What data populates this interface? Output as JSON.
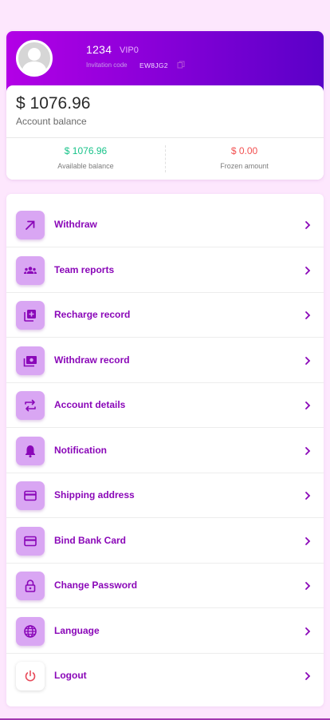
{
  "profile": {
    "username": "1234",
    "vip_level": "VIP0",
    "invitation_label": "Invitation code",
    "invitation_code": "EW8JG2",
    "balance": "$ 1076.96",
    "balance_label": "Account balance",
    "available_value": "$ 1076.96",
    "available_label": "Available balance",
    "frozen_value": "$ 0.00",
    "frozen_label": "Frozen amount"
  },
  "menu": {
    "items": [
      {
        "label": "Withdraw",
        "icon": "arrow-up-right-icon"
      },
      {
        "label": "Team reports",
        "icon": "team-icon"
      },
      {
        "label": "Recharge record",
        "icon": "add-box-icon"
      },
      {
        "label": "Withdraw record",
        "icon": "cash-icon"
      },
      {
        "label": "Account details",
        "icon": "swap-icon"
      },
      {
        "label": "Notification",
        "icon": "bell-icon"
      },
      {
        "label": "Shipping address",
        "icon": "card-icon"
      },
      {
        "label": "Bind Bank Card",
        "icon": "card-icon"
      },
      {
        "label": "Change Password",
        "icon": "lock-icon"
      },
      {
        "label": "Language",
        "icon": "globe-icon"
      },
      {
        "label": "Logout",
        "icon": "power-icon"
      }
    ]
  },
  "colors": {
    "header_gradient_start": "#b300e6",
    "header_gradient_end": "#5a00c8",
    "menu_label": "#8a07b8",
    "icon_tile": "#d9a6f3",
    "positive": "#19c38a",
    "negative": "#f25050"
  }
}
